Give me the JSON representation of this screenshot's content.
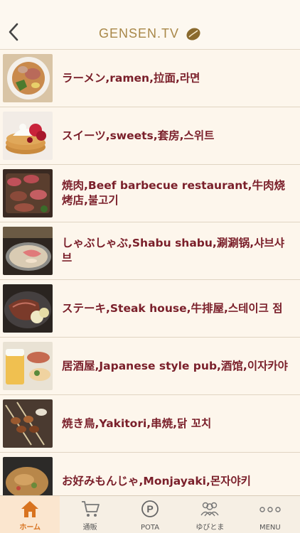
{
  "header": {
    "logo_text": "GENSEN.TV",
    "back_icon": "chevron-left-icon"
  },
  "colors": {
    "accent": "#d8731f",
    "label": "#7a1f2a",
    "logo": "#a88748",
    "background": "#fcf7ef"
  },
  "categories": [
    {
      "label": "ラーメン,ramen,拉面,라면",
      "thumb": "ramen-photo"
    },
    {
      "label": "スイーツ,sweets,套房,스위트",
      "thumb": "sweets-photo"
    },
    {
      "label": "焼肉,Beef barbecue restaurant,牛肉烧烤店,불고기",
      "thumb": "yakiniku-photo"
    },
    {
      "label": "しゃぶしゃぶ,Shabu shabu,涮涮锅,샤브샤브",
      "thumb": "shabu-photo"
    },
    {
      "label": "ステーキ,Steak house,牛排屋,스테이크 점",
      "thumb": "steak-photo"
    },
    {
      "label": "居酒屋,Japanese style pub,酒馆,이자카야",
      "thumb": "izakaya-photo"
    },
    {
      "label": "焼き鳥,Yakitori,串焼,닭 꼬치",
      "thumb": "yakitori-photo"
    },
    {
      "label": "お好みもんじゃ,Monjayaki,몬자야키",
      "thumb": "monja-photo"
    }
  ],
  "tabbar": {
    "items": [
      {
        "label": "ホーム",
        "icon": "home-icon"
      },
      {
        "label": "通販",
        "icon": "cart-icon"
      },
      {
        "label": "POTA",
        "icon": "parking-circle-icon"
      },
      {
        "label": "ゆびとま",
        "icon": "people-icon"
      },
      {
        "label": "MENU",
        "icon": "more-dots-icon"
      }
    ]
  }
}
